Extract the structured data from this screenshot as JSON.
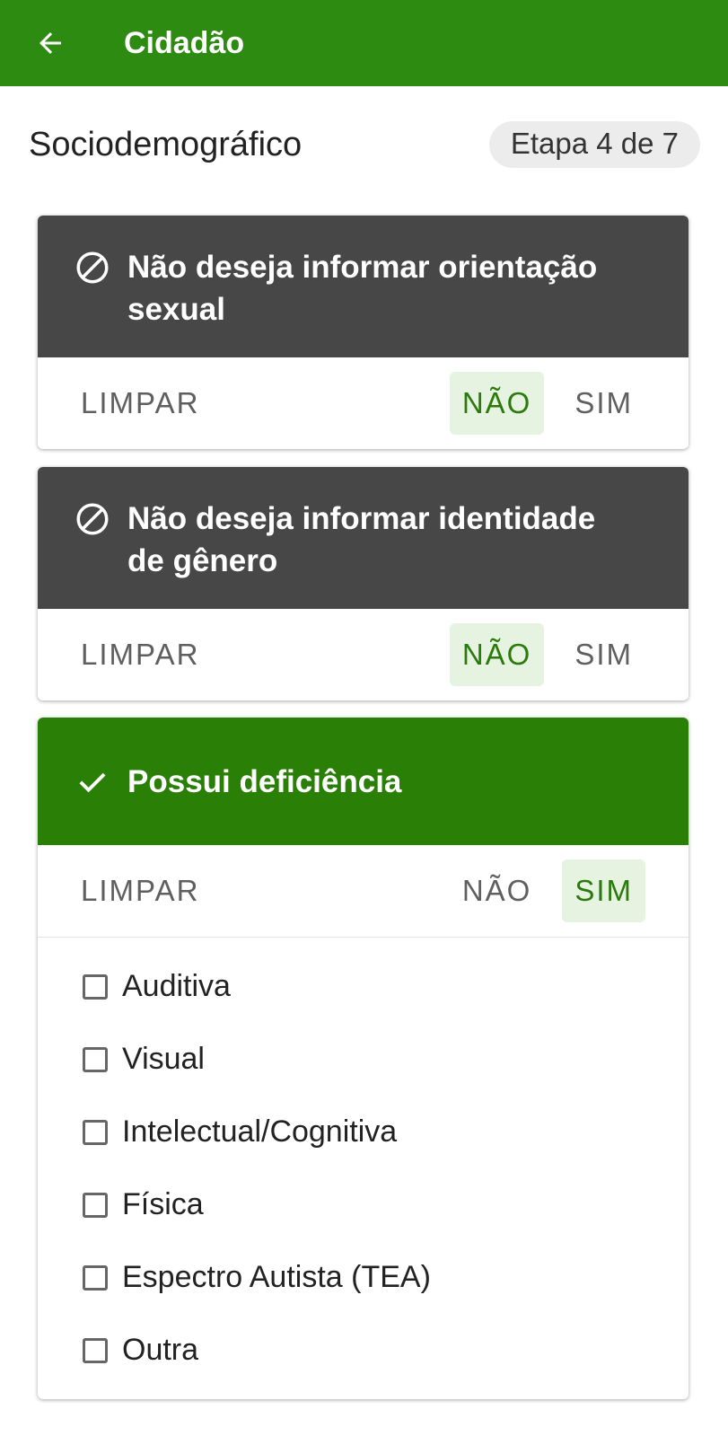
{
  "appbar": {
    "title": "Cidadão",
    "back_icon": "arrow-left-icon",
    "color": "#2e8b12"
  },
  "header": {
    "title": "Sociodemográfico",
    "step": "Etapa 4 de 7"
  },
  "cards": [
    {
      "title_line1": "Não deseja informar orientação",
      "title_line2": "sexual",
      "icon": "block-icon",
      "clear": "LIMPAR",
      "no": "NÃO",
      "yes": "SIM",
      "selected": "NÃO"
    },
    {
      "title_line1": "Não deseja informar identidade",
      "title_line2": "de gênero",
      "icon": "block-icon",
      "clear": "LIMPAR",
      "no": "NÃO",
      "yes": "SIM",
      "selected": "NÃO"
    },
    {
      "title": "Possui deficiência",
      "icon": "check-icon",
      "clear": "LIMPAR",
      "no": "NÃO",
      "yes": "SIM",
      "selected": "SIM",
      "options": [
        "Auditiva",
        "Visual",
        "Intelectual/Cognitiva",
        "Física",
        "Espectro Autista (TEA)",
        "Outra"
      ]
    }
  ],
  "colors": {
    "dark_header": "#474747",
    "selected_green": "#2a7f07",
    "selected_bg": "#e6f3e1"
  }
}
